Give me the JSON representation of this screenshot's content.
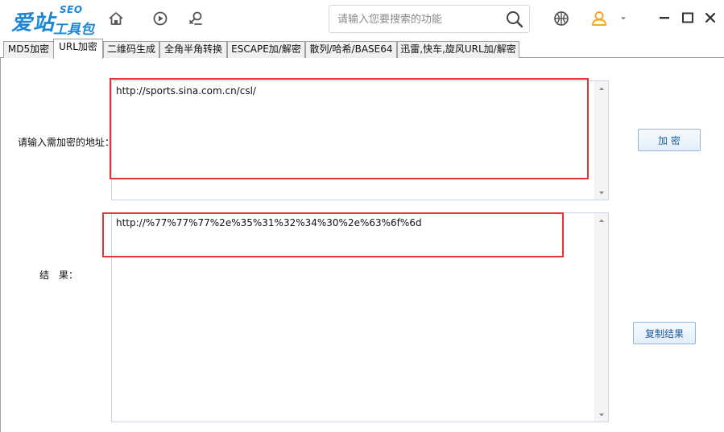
{
  "app": {
    "logo_main": "爱站",
    "logo_sub": "工具包",
    "logo_seo": "SEO"
  },
  "search": {
    "placeholder": "请输入您要搜索的功能",
    "value": ""
  },
  "icons": {
    "home": "home-icon",
    "play": "play-icon",
    "plugin": "plugin-icon",
    "search": "search-icon",
    "basketball": "basketball-icon",
    "user": "user-avatar-icon",
    "dropdown": "chevron-down-icon",
    "minimize": "minimize-icon",
    "maximize": "maximize-icon",
    "close": "close-icon"
  },
  "tabs": [
    {
      "label": "MD5加密"
    },
    {
      "label": "URL加密"
    },
    {
      "label": "二维码生成"
    },
    {
      "label": "全角半角转换"
    },
    {
      "label": "ESCAPE加/解密"
    },
    {
      "label": "散列/哈希/BASE64"
    },
    {
      "label": "迅雷,快车,旋风URL加/解密"
    }
  ],
  "active_tab": "URL加密",
  "form": {
    "input_label": "请输入需加密的地址：",
    "input_value": "http://sports.sina.com.cn/csl/",
    "result_label": "结　果：",
    "result_value": "http://%77%77%77%2e%35%31%32%34%30%2e%63%6f%6d",
    "encrypt_button": "加  密",
    "copy_button": "复制结果"
  },
  "colors": {
    "accent": "#1a86d6",
    "user_icon": "#f5a623",
    "highlight_box": "#e53333"
  }
}
